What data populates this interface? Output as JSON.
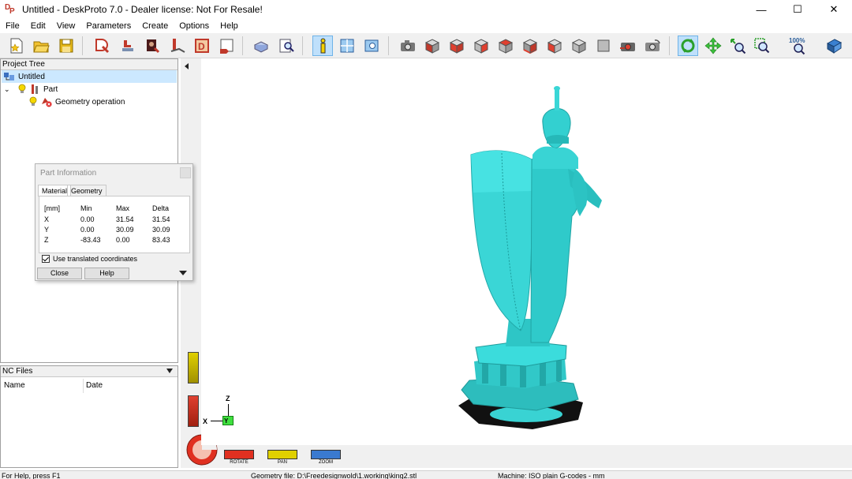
{
  "window": {
    "title": "Untitled - DeskProto 7.0 - Dealer license: Not For Resale!",
    "minimize": "—",
    "maximize": "☐",
    "close": "✕"
  },
  "menu": [
    "File",
    "Edit",
    "View",
    "Parameters",
    "Create",
    "Options",
    "Help"
  ],
  "toolbar": {
    "zoom_label": "100%"
  },
  "project_tree": {
    "header": "Project Tree",
    "root": "Untitled",
    "part": "Part",
    "operation": "Geometry operation"
  },
  "nc_files": {
    "header": "NC Files",
    "columns": [
      "Name",
      "Date"
    ]
  },
  "part_info": {
    "title": "Part Information",
    "tabs": [
      "Material",
      "Geometry"
    ],
    "headers": [
      "[mm]",
      "Min",
      "Max",
      "Delta"
    ],
    "rows": [
      [
        "X",
        "0.00",
        "31.54",
        "31.54"
      ],
      [
        "Y",
        "0.00",
        "30.09",
        "30.09"
      ],
      [
        "Z",
        "-83.43",
        "0.00",
        "83.43"
      ]
    ],
    "checkbox_label": "Use translated coordinates",
    "close_label": "Close",
    "help_label": "Help"
  },
  "axes": {
    "z": "Z",
    "x": "X",
    "y": "Y"
  },
  "view_controls": {
    "rotate": "ROTATE",
    "pan": "PAN",
    "zoom": "ZOOM"
  },
  "status": {
    "help": "For Help, press F1",
    "geometry_file": "Geometry file: D:\\Freedesignwold\\1.working\\king2.stl",
    "machine": "Machine: ISO plain G-codes - mm"
  },
  "colors": {
    "model": "#3ad6d6",
    "model_shade": "#23a9ac",
    "base_bottom": "#222222",
    "selection": "#cce8ff",
    "toolbar_bg": "#f0f0f0"
  }
}
